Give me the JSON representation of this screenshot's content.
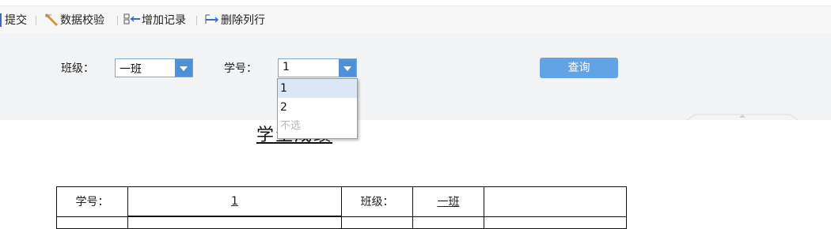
{
  "toolbar": {
    "submit": "提交",
    "validate": "数据校验",
    "add_record": "增加记录",
    "delete_row": "删除列行"
  },
  "filters": {
    "class_label": "班级：",
    "class_value": "一班",
    "student_no_label": "学号：",
    "student_no_value": "1",
    "query_button": "查询"
  },
  "dropdown": {
    "options": [
      "1",
      "2",
      "不选"
    ],
    "selected": "1"
  },
  "report": {
    "title": "学生成绩",
    "row1": {
      "student_no_label": "学号：",
      "student_no_value": "1",
      "class_label": "班级：",
      "class_value": "一班"
    }
  },
  "colors": {
    "combo_button": "#4f90d9",
    "query_button": "#62a3e6",
    "selected_option": "#dbe6f7"
  }
}
